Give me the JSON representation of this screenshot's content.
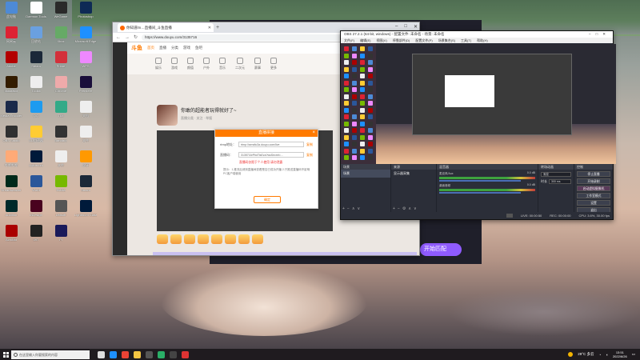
{
  "desktop": {
    "icons": [
      {
        "label": "此电脑",
        "icon": "computer-icon",
        "color": "#4d8ad6"
      },
      {
        "label": "Daemon Tools",
        "icon": "app-icon",
        "color": "#ffffff"
      },
      {
        "label": "WeGame",
        "icon": "app-icon",
        "color": "#2a2a2a"
      },
      {
        "label": "Photoshop",
        "icon": "photoshop-icon",
        "color": "#0e2a55"
      },
      {
        "label": "网易云",
        "icon": "app-icon",
        "color": "#d23"
      },
      {
        "label": "回收站",
        "icon": "trash-icon",
        "color": "#6aa0e0"
      },
      {
        "label": "Xbox",
        "icon": "app-icon",
        "color": "#6a6"
      },
      {
        "label": "Microsoft Edge",
        "icon": "edge-icon",
        "color": "#1e90ff"
      },
      {
        "label": "Adobe",
        "icon": "app-icon",
        "color": "#b30000"
      },
      {
        "label": "Steam",
        "icon": "steam-icon",
        "color": "#1b2838"
      },
      {
        "label": "Prime",
        "icon": "app-icon",
        "color": "#d3303a"
      },
      {
        "label": "WPS",
        "icon": "app-icon",
        "color": "#e8f"
      },
      {
        "label": "Illustrator",
        "icon": "illustrator-icon",
        "color": "#331c00"
      },
      {
        "label": "Toolkit",
        "icon": "app-icon",
        "color": "#eee"
      },
      {
        "label": "Chrome",
        "icon": "chrome-icon",
        "color": "#eaa"
      },
      {
        "label": "Premiere",
        "icon": "premiere-icon",
        "color": "#1a0f3a"
      },
      {
        "label": "Media Encoder",
        "icon": "app-icon",
        "color": "#1a2a4a"
      },
      {
        "label": "QQ",
        "icon": "qq-icon",
        "color": "#1d9bf0"
      },
      {
        "label": "TIM",
        "icon": "app-icon",
        "color": "#3a8"
      },
      {
        "label": "文档",
        "icon": "file-icon",
        "color": "#eee"
      },
      {
        "label": "OBS Studio",
        "icon": "obs-icon",
        "color": "#303030"
      },
      {
        "label": "UU加速器",
        "icon": "app-icon",
        "color": "#fc3"
      },
      {
        "label": "Bandizip",
        "icon": "app-icon",
        "color": "#333"
      },
      {
        "label": "文件",
        "icon": "file-icon",
        "color": "#eee"
      },
      {
        "label": "哔哩哔哩",
        "icon": "app-icon",
        "color": "#fa7"
      },
      {
        "label": "Lightroom",
        "icon": "lightroom-icon",
        "color": "#001a3a"
      },
      {
        "label": "文件",
        "icon": "file-icon",
        "color": "#eee"
      },
      {
        "label": "虎牙",
        "icon": "app-icon",
        "color": "#f90"
      },
      {
        "label": "Dreamweaver",
        "icon": "dreamweaver-icon",
        "color": "#002a1a"
      },
      {
        "label": "Word",
        "icon": "word-icon",
        "color": "#2b579a"
      },
      {
        "label": "Nvidia",
        "icon": "nvidia-icon",
        "color": "#76b900"
      },
      {
        "label": "Steam",
        "icon": "steam-icon",
        "color": "#1b2838"
      },
      {
        "label": "Audition",
        "icon": "audition-icon",
        "color": "#002a2a"
      },
      {
        "label": "InDesign",
        "icon": "indesign-icon",
        "color": "#49021f"
      },
      {
        "label": "Ubisoft",
        "icon": "app-icon",
        "color": "#555"
      },
      {
        "label": "Lightroom Classic",
        "icon": "lightroom-icon",
        "color": "#001a3a"
      },
      {
        "label": "Acrobat",
        "icon": "acrobat-icon",
        "color": "#a00"
      },
      {
        "label": "097",
        "icon": "app-icon",
        "color": "#222"
      },
      {
        "label": "Pl",
        "icon": "app-icon",
        "color": "#1a1a5a"
      }
    ]
  },
  "browser": {
    "tab_title": "你知道lm…直播间_斗鱼直播",
    "url": "https://www.douyu.com/3135716",
    "window_buttons": [
      "–",
      "□",
      "✕"
    ],
    "site": {
      "logo": "斗鱼",
      "nav": [
        "首页",
        "直播",
        "分类",
        "游戏",
        "鱼吧"
      ],
      "categories": [
        "娱乐",
        "游戏",
        "颜值",
        "户外",
        "音乐",
        "二次元",
        "赛事",
        "更多"
      ],
      "room_title": "你敢的超能者玩得就好了~",
      "room_meta": "直播分类 · 关注 · 举报"
    }
  },
  "modal": {
    "title": "直播拼接",
    "close": "×",
    "rtmp_label": "rtmp地址：",
    "rtmp_value": "rtmp://sendtc3a.douyu.com/live",
    "rtmp_copy": "复制",
    "code_label": "直播码：",
    "code_value": "3135716rPbdTisEza?wsSecret=…",
    "code_copy": "复制",
    "warning": "直播码仅限于个人使用 请勿泄露",
    "note": "提示：1.推流后请到直播间查看是否已成功开播 2.只推送直播码不影响PC客户端使用",
    "confirm": "确定"
  },
  "background_window": {
    "match_button": "开始匹配"
  },
  "obs": {
    "title": "OBS 27.2.1 (64-bit, windows) - 配置文件: 未命名 - 场景: 未命名",
    "menu": [
      "文件(F)",
      "编辑(E)",
      "视图(V)",
      "停靠部件(D)",
      "配置文件(P)",
      "场景集合(S)",
      "工具(T)",
      "帮助(H)"
    ],
    "docks": {
      "scenes": {
        "header": "场景",
        "items": [
          "场景"
        ]
      },
      "sources": {
        "header": "来源",
        "items": [
          "显示器采集"
        ]
      },
      "mixer": {
        "header": "混音器",
        "channels": [
          {
            "name": "麦克风/Aux",
            "db": "0.0 dB"
          },
          {
            "name": "桌面音频",
            "db": "0.0 dB"
          }
        ]
      },
      "transitions": {
        "header": "转场动画",
        "type_label": "渐变",
        "duration_label": "时长",
        "duration_value": "300 ms"
      },
      "controls": {
        "header": "控制",
        "buttons": [
          "停止直播",
          "开始录制",
          "启动虚拟摄像机",
          "工作室模式",
          "设置",
          "退出"
        ]
      }
    },
    "no_source_label": "未选择源",
    "status": {
      "live": "LIVE: 00:00:50",
      "rec": "REC: 00:00:00",
      "cpu": "CPU: 3.6%, 30.00 fps",
      "kbps": "kb/s: 0"
    }
  },
  "taskbar": {
    "search_placeholder": "在这里输入你要搜索的内容",
    "weather": "29°C 多云",
    "time": "13:51",
    "date": "2022/6/26",
    "pinned": [
      {
        "icon": "task-view-icon",
        "color": "#ddd"
      },
      {
        "icon": "edge-icon",
        "color": "#1e90ff"
      },
      {
        "icon": "chrome-icon",
        "color": "#ea4335"
      },
      {
        "icon": "folder-icon",
        "color": "#f4c542"
      },
      {
        "icon": "store-icon",
        "color": "#555"
      },
      {
        "icon": "wechat-icon",
        "color": "#2aae67"
      },
      {
        "icon": "obs-icon",
        "color": "#444"
      },
      {
        "icon": "app-icon",
        "color": "#d33"
      }
    ]
  }
}
